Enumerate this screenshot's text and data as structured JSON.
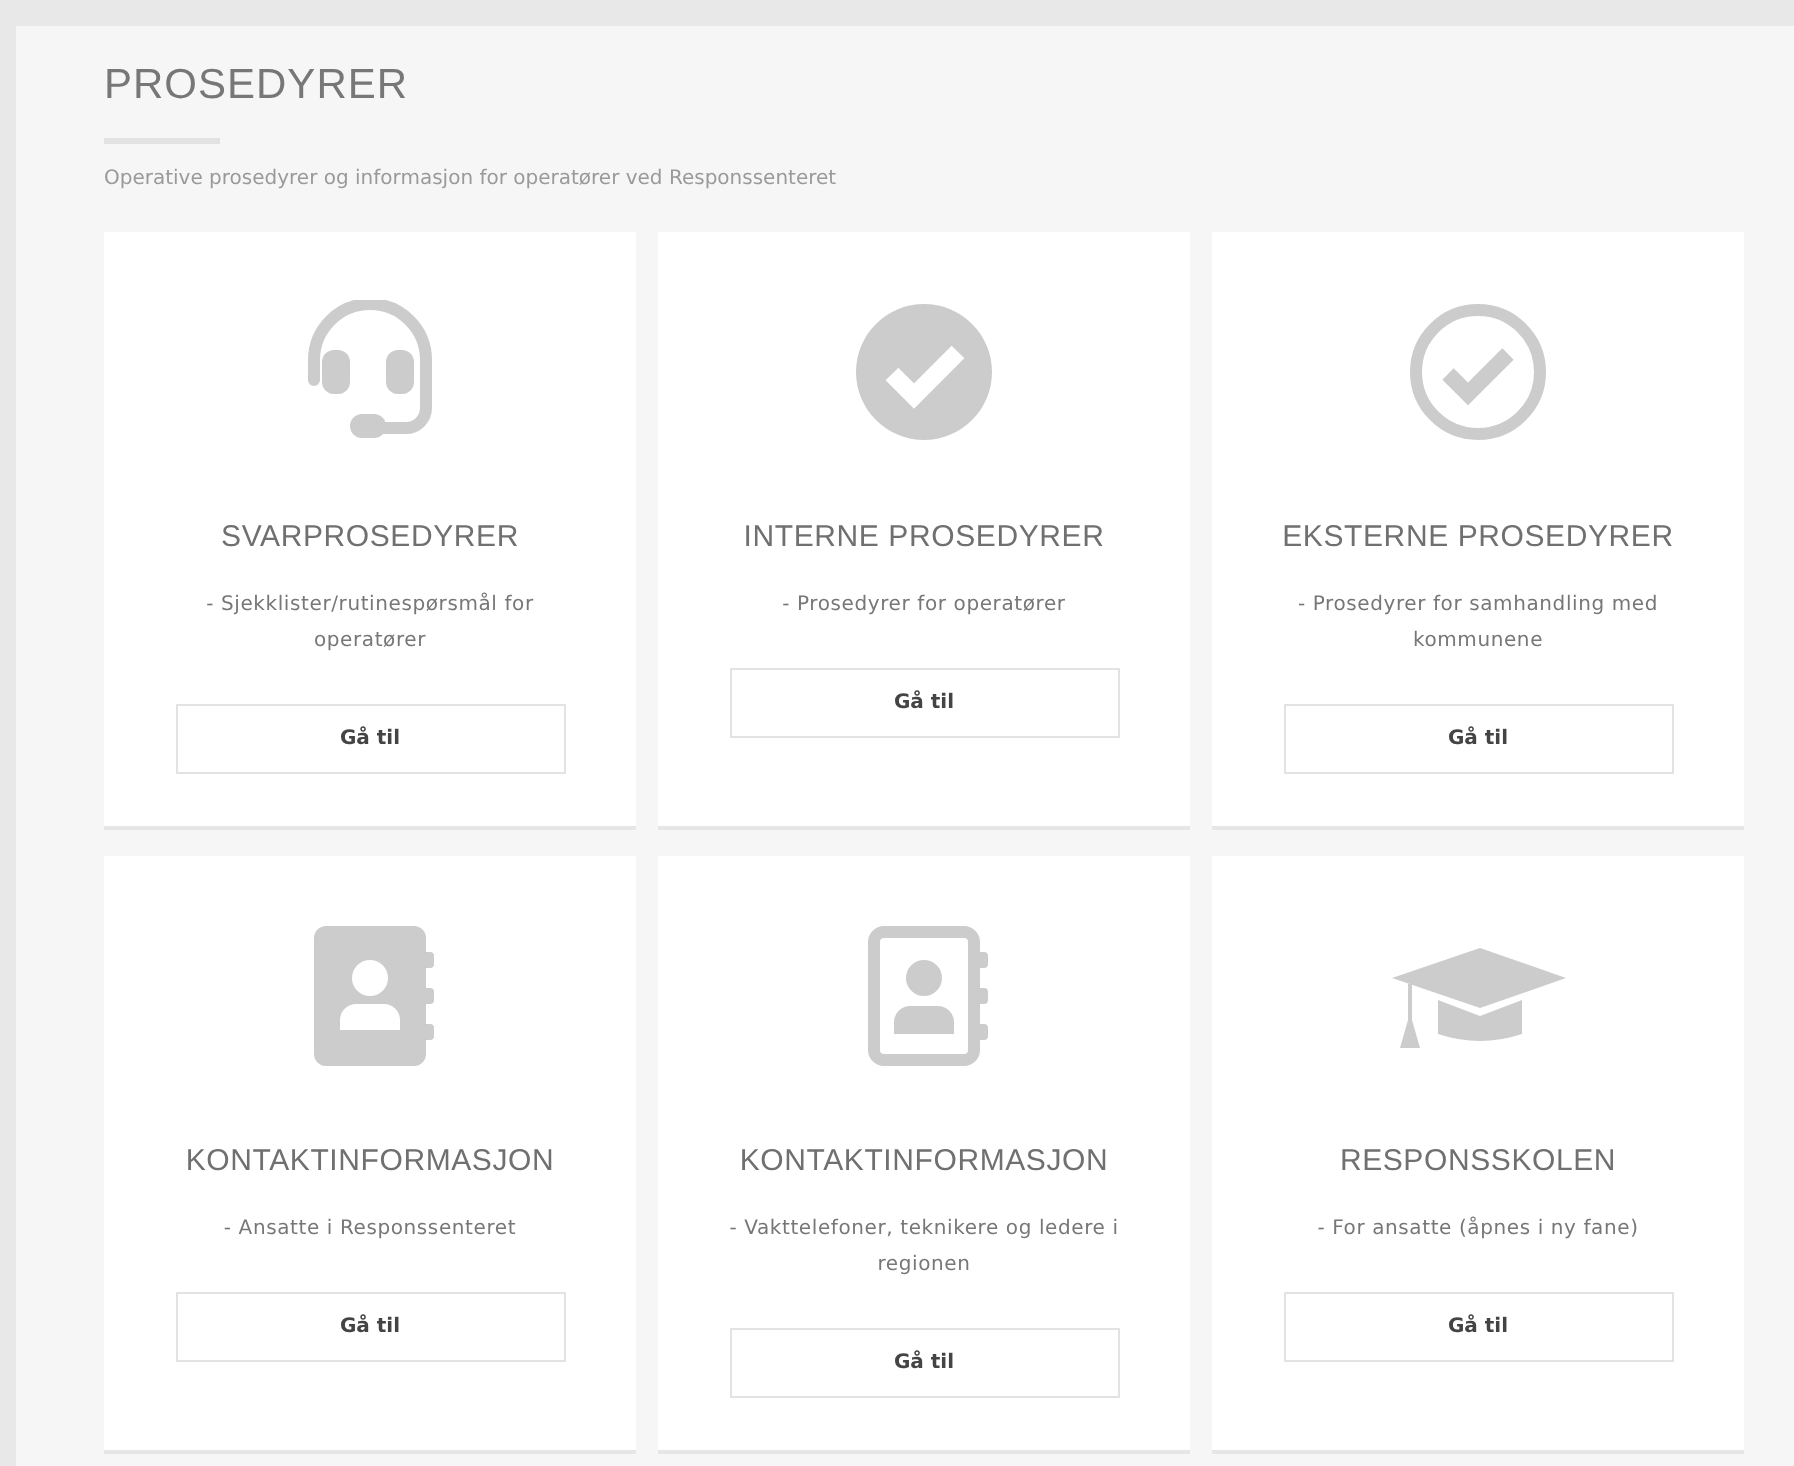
{
  "page": {
    "title": "PROSEDYRER",
    "subtitle": "Operative prosedyrer og informasjon for operatører ved Responssenteret"
  },
  "cards": [
    {
      "kind": "headset",
      "title": "SVARPROSEDYRER",
      "description": "- Sjekklister/rutinespørsmål for operatører",
      "button": "Gå til"
    },
    {
      "kind": "check-filled",
      "title": "INTERNE PROSEDYRER",
      "description": "- Prosedyrer for operatører",
      "button": "Gå til"
    },
    {
      "kind": "check-outline",
      "title": "EKSTERNE PROSEDYRER",
      "description": "- Prosedyrer for samhandling med kommunene",
      "button": "Gå til"
    },
    {
      "kind": "contacts-filled",
      "title": "KONTAKTINFORMASJON",
      "description": "- Ansatte i Responssenteret",
      "button": "Gå til"
    },
    {
      "kind": "contacts-outline",
      "title": "KONTAKTINFORMASJON",
      "description": "- Vakttelefoner, teknikere og ledere i regionen",
      "button": "Gå til"
    },
    {
      "kind": "cap",
      "title": "RESPONSSKOLEN",
      "description": "- For ansatte (åpnes i ny fane)",
      "button": "Gå til"
    }
  ]
}
